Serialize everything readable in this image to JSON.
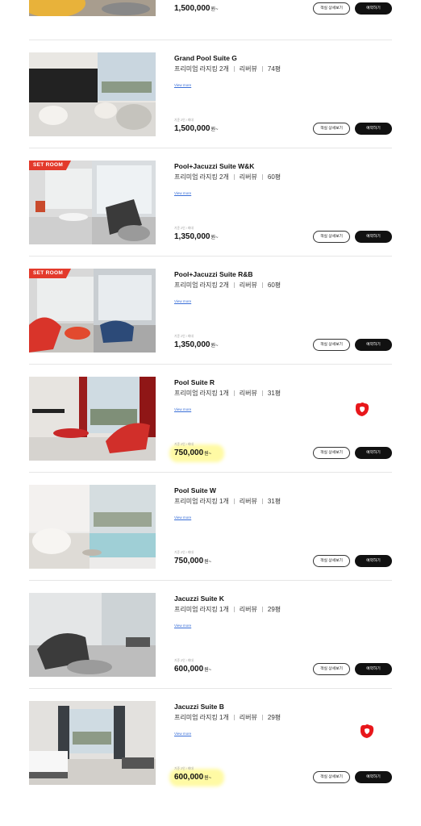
{
  "buttons": {
    "detail_label": "객실 상세보기",
    "book_label": "예약하기"
  },
  "rooms": [
    {
      "name": "",
      "spec_bed": "",
      "spec_view": "",
      "spec_size": "",
      "more": "",
      "price_label": "",
      "price": "1,500,000",
      "unit": "원~"
    },
    {
      "name": "Grand Pool Suite G",
      "spec_bed": "프리미엄 라지킹 2개",
      "spec_view": "리버뷰",
      "spec_size": "74평",
      "more": "View more",
      "price_label": "기준 2인 / 최대",
      "price": "1,500,000",
      "unit": "원~"
    },
    {
      "name": "Pool+Jacuzzi Suite W&K",
      "badge": "SET ROOM",
      "spec_bed": "프리미엄 라지킹 2개",
      "spec_view": "리버뷰",
      "spec_size": "60평",
      "more": "View more",
      "price_label": "기준 2인 / 최대",
      "price": "1,350,000",
      "unit": "원~"
    },
    {
      "name": "Pool+Jacuzzi Suite R&B",
      "badge": "SET ROOM",
      "spec_bed": "프리미엄 라지킹 2개",
      "spec_view": "리버뷰",
      "spec_size": "60평",
      "more": "View more",
      "price_label": "기준 2인 / 최대",
      "price": "1,350,000",
      "unit": "원~"
    },
    {
      "name": "Pool Suite R",
      "spec_bed": "프리미엄 라지킹 1개",
      "spec_view": "리버뷰",
      "spec_size": "31평",
      "more": "View more",
      "price_label": "기준 2인 / 최대",
      "price": "750,000",
      "unit": "원~"
    },
    {
      "name": "Pool Suite W",
      "spec_bed": "프리미엄 라지킹 1개",
      "spec_view": "리버뷰",
      "spec_size": "31평",
      "more": "View more",
      "price_label": "기준 2인 / 최대",
      "price": "750,000",
      "unit": "원~"
    },
    {
      "name": "Jacuzzi Suite K",
      "spec_bed": "프리미엄 라지킹 1개",
      "spec_view": "리버뷰",
      "spec_size": "29평",
      "more": "View more",
      "price_label": "기준 2인 / 최대",
      "price": "600,000",
      "unit": "원~"
    },
    {
      "name": "Jacuzzi Suite B",
      "spec_bed": "프리미엄 라지킹 1개",
      "spec_view": "리버뷰",
      "spec_size": "29평",
      "more": "View more",
      "price_label": "기준 2인 / 최대",
      "price": "600,000",
      "unit": "원~"
    }
  ],
  "colors": {
    "accent": "#e33a2b",
    "button_dark": "#111111",
    "highlight": "#fff55a",
    "link": "#3a6fd8"
  }
}
